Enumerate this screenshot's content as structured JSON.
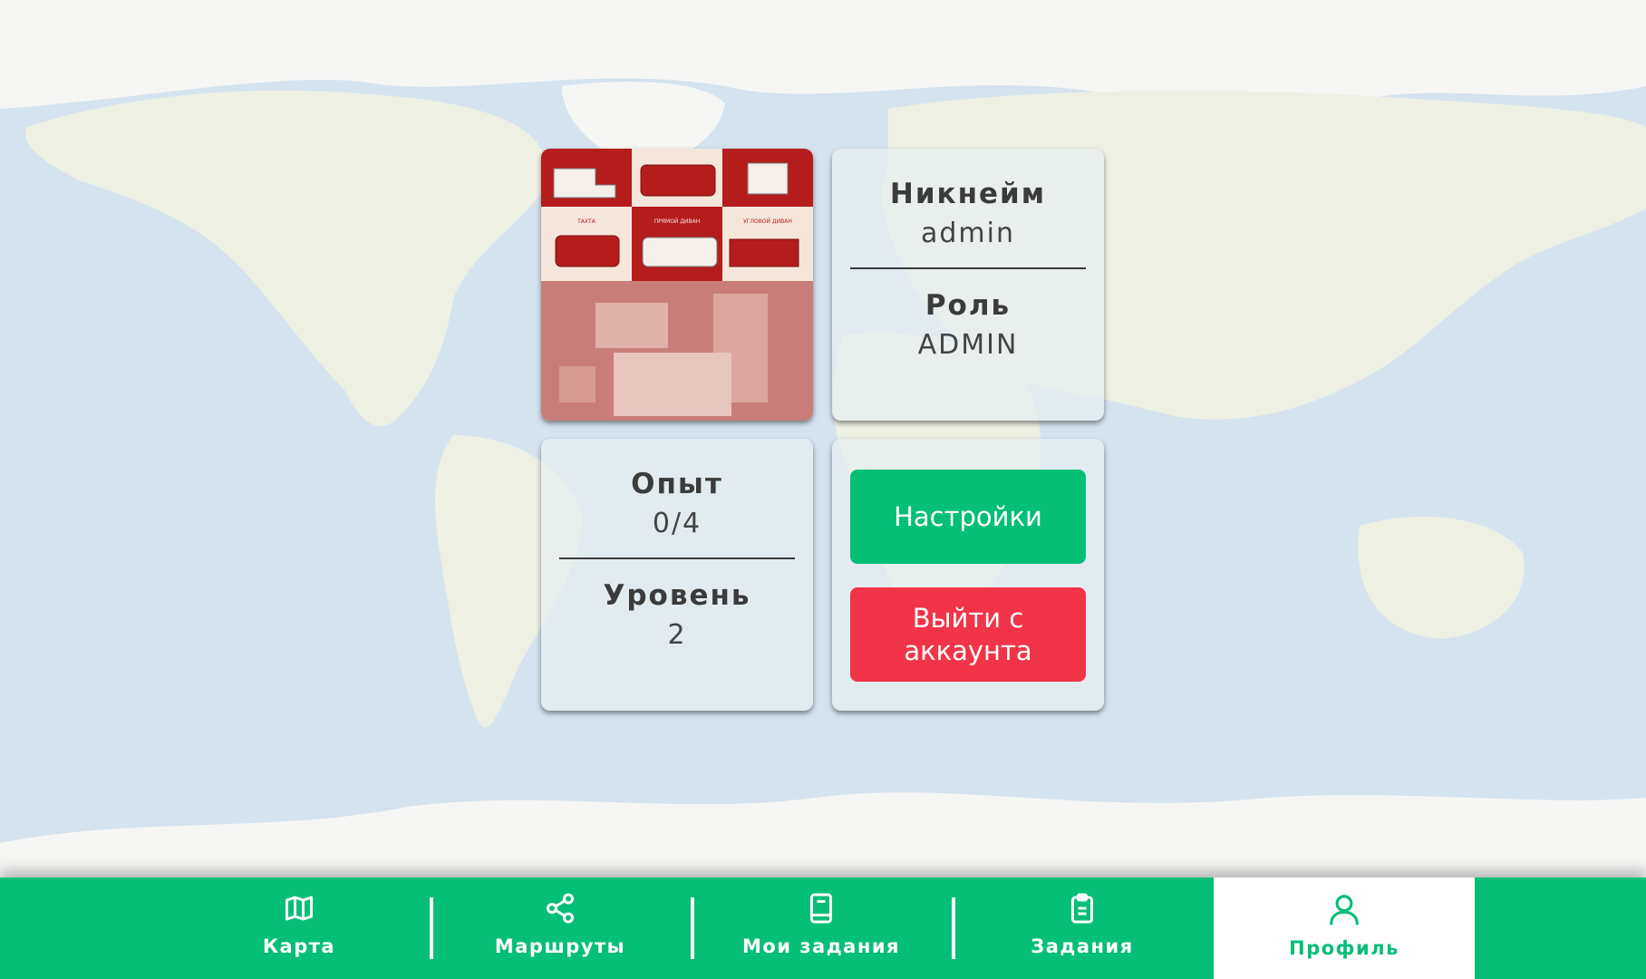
{
  "profile": {
    "nickname_label": "Никнейм",
    "nickname_value": "admin",
    "role_label": "Роль",
    "role_value": "ADMIN",
    "experience_label": "Опыт",
    "experience_value": "0/4",
    "level_label": "Уровень",
    "level_value": "2"
  },
  "actions": {
    "settings_label": "Настройки",
    "logout_label": "Выйти с аккаунта"
  },
  "avatar": {
    "labels": [
      "ТАХТА",
      "ПРЯМОЙ ДИВАН",
      "УГЛОВОЙ ДИВАН"
    ]
  },
  "nav": {
    "items": [
      {
        "label": "Карта",
        "icon": "map-icon"
      },
      {
        "label": "Маршруты",
        "icon": "share-icon"
      },
      {
        "label": "Мои задания",
        "icon": "book-icon"
      },
      {
        "label": "Задания",
        "icon": "clipboard-icon"
      },
      {
        "label": "Профиль",
        "icon": "user-icon"
      }
    ],
    "active_index": 4
  },
  "colors": {
    "accent": "#06bf77",
    "danger": "#f23448",
    "ocean": "#d5e3ef",
    "land": "#eef0e4"
  }
}
